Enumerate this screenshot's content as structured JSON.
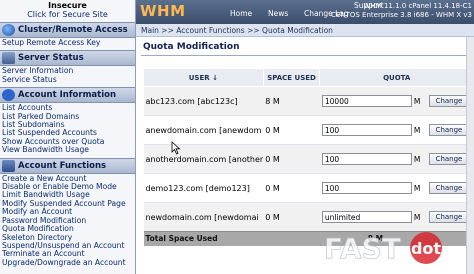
{
  "sidebar": {
    "insecure_title": "Insecure",
    "insecure_link": "Click for Secure Site",
    "sections": [
      {
        "title": "Cluster/Remote Access",
        "icon": "globe-icon",
        "items": [
          "Setup Remote Access Key"
        ]
      },
      {
        "title": "Server Status",
        "icon": "server-icon",
        "items": [
          "Server Information",
          "Service Status"
        ]
      },
      {
        "title": "Account Information",
        "icon": "info-icon",
        "items": [
          "List Accounts",
          "List Parked Domains",
          "List Subdomains",
          "List Suspended Accounts",
          "Show Accounts over Quota",
          "View Bandwidth Usage"
        ]
      },
      {
        "title": "Account Functions",
        "icon": "functions-icon",
        "items": [
          "Create a New Account",
          "Disable or Enable Demo Mode",
          "Limit Bandwidth Usage",
          "Modify Suspended Account Page",
          "Modify an Account",
          "Password Modification",
          "Quota Modification",
          "Skeleton Directory",
          "Suspend/Unsuspend an Account",
          "Terminate an Account",
          "Upgrade/Downgrade an Account"
        ]
      }
    ]
  },
  "header": {
    "logo": "WHM",
    "nav": [
      "Home",
      "News",
      "Change Log",
      "Support"
    ],
    "version_line1": "WHM 11.1.0 cPanel 11.4.18-C1",
    "version_line2": "CENTOS Enterprise 3.8 i686 - WHM X v3"
  },
  "breadcrumb": "Main >> Account Functions >> Quota Modification",
  "page_title": "Quota Modification",
  "table": {
    "columns": [
      "User",
      "Space Used",
      "Quota"
    ],
    "sort_icon": "sort-down-arrow-icon",
    "rows": [
      {
        "user": "abc123.com [abc123c]",
        "used": "8 M",
        "quota": "10000",
        "unit": "M",
        "button": "Change"
      },
      {
        "user": "anewdomain.com [anewdom",
        "used": "0 M",
        "quota": "100",
        "unit": "M",
        "button": "Change"
      },
      {
        "user": "anotherdomain.com [another",
        "used": "0 M",
        "quota": "100",
        "unit": "M",
        "button": "Change"
      },
      {
        "user": "demo123.com [demo123]",
        "used": "0 M",
        "quota": "100",
        "unit": "M",
        "button": "Change"
      },
      {
        "user": "newdomain.com [newdomai",
        "used": "0 M",
        "quota": "unlimited",
        "unit": "M",
        "button": "Change"
      }
    ],
    "total_label": "Total Space Used",
    "total_value": "8 M"
  },
  "watermark": {
    "word": "FAST",
    "dot_word": "dot"
  },
  "colors": {
    "header_bg": "#4a5d7e",
    "logo": "#ffb84d",
    "watermark_dot": "#d8232a"
  }
}
